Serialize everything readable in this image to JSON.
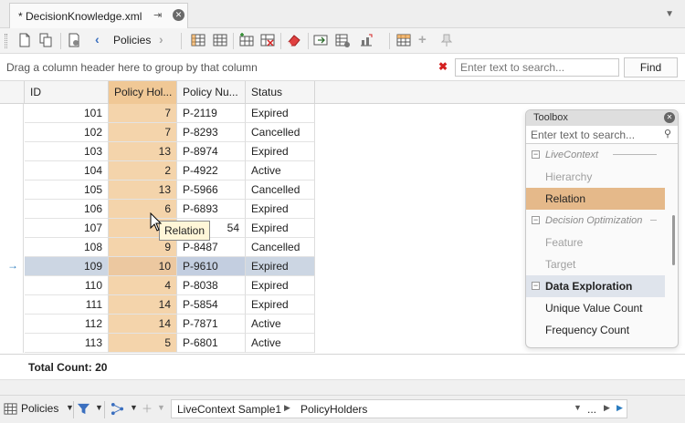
{
  "tab": {
    "title": "* DecisionKnowledge.xml",
    "pin_icon": "pin-icon",
    "close_icon": "close-icon"
  },
  "toolbar": {
    "nav_label": "Policies",
    "back_icon": "chevron-left-icon",
    "forward_icon": "chevron-right-icon"
  },
  "groupbar": {
    "hint": "Drag a column header here to group by that column",
    "clear_symbol": "✖",
    "search_placeholder": "Enter text to search...",
    "find_label": "Find"
  },
  "grid": {
    "columns": [
      "ID",
      "Policy Hol...",
      "Policy Nu...",
      "Status"
    ],
    "rows": [
      {
        "id": "101",
        "holder": "7",
        "number": "P-2119",
        "status": "Expired"
      },
      {
        "id": "102",
        "holder": "7",
        "number": "P-8293",
        "status": "Cancelled"
      },
      {
        "id": "103",
        "holder": "13",
        "number": "P-8974",
        "status": "Expired"
      },
      {
        "id": "104",
        "holder": "2",
        "number": "P-4922",
        "status": "Active"
      },
      {
        "id": "105",
        "holder": "13",
        "number": "P-5966",
        "status": "Cancelled"
      },
      {
        "id": "106",
        "holder": "6",
        "number": "P-6893",
        "status": "Expired"
      },
      {
        "id": "107",
        "holder": "",
        "number": "54",
        "status": "Expired"
      },
      {
        "id": "108",
        "holder": "9",
        "number": "P-8487",
        "status": "Cancelled"
      },
      {
        "id": "109",
        "holder": "10",
        "number": "P-9610",
        "status": "Expired"
      },
      {
        "id": "110",
        "holder": "4",
        "number": "P-8038",
        "status": "Expired"
      },
      {
        "id": "111",
        "holder": "14",
        "number": "P-5854",
        "status": "Expired"
      },
      {
        "id": "112",
        "holder": "14",
        "number": "P-7871",
        "status": "Active"
      },
      {
        "id": "113",
        "holder": "5",
        "number": "P-6801",
        "status": "Active"
      }
    ],
    "current_row_indicator": "→",
    "total": "Total Count: 20"
  },
  "drag_tooltip": "Relation",
  "toolbox": {
    "title": "Toolbox",
    "search_placeholder": "Enter text to search...",
    "groups": {
      "live_context": "LiveContext",
      "decision_optimization": "Decision Optimization",
      "data_exploration": "Data Exploration"
    },
    "items": {
      "hierarchy": "Hierarchy",
      "relation": "Relation",
      "feature": "Feature",
      "target": "Target",
      "unique_value_count": "Unique Value Count",
      "frequency_count": "Frequency Count"
    },
    "toggle_symbol": "−"
  },
  "statusbar": {
    "view_label": "Policies",
    "crumbs": [
      "LiveContext Sample1",
      "PolicyHolders"
    ],
    "more": "..."
  }
}
